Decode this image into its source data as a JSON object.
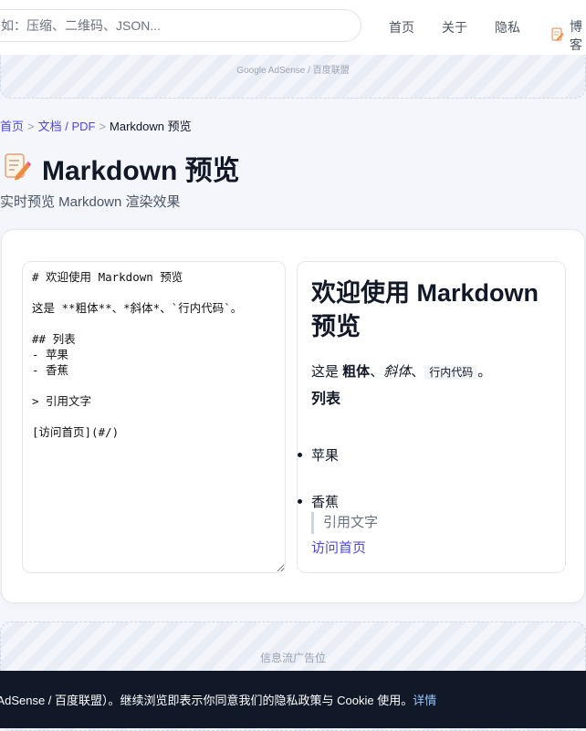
{
  "header": {
    "search_placeholder": "如：压缩、二维码、JSON...",
    "nav": {
      "home": "首页",
      "about": "关于",
      "privacy": "隐私",
      "blog": "博客"
    }
  },
  "ad_top": {
    "label": "Google AdSense / 百度联盟"
  },
  "breadcrumb": {
    "home": "首页",
    "sep": ">",
    "category": "文档 / PDF",
    "current": "Markdown 预览"
  },
  "page": {
    "icon": "memo-pencil-icon",
    "title": "Markdown 预览",
    "subtitle": "实时预览 Markdown 渲染效果"
  },
  "editor": {
    "value": "# 欢迎使用 Markdown 预览\n\n这是 **粗体**、*斜体*、`行内代码`。\n\n## 列表\n- 苹果\n- 香蕉\n\n> 引用文字\n\n[访问首页](#/)"
  },
  "preview": {
    "h1": "欢迎使用 Markdown 预览",
    "p_prefix": "这是 ",
    "bold": "粗体",
    "sep1": "、",
    "italic": "斜体",
    "sep2": "、",
    "code": "行内代码",
    "p_suffix": "。",
    "h2": "列表",
    "items": [
      "苹果",
      "香蕉"
    ],
    "quote": "引用文字",
    "link": "访问首页"
  },
  "ad_feed": {
    "label": "信息流广告位"
  },
  "cookie": {
    "text": "本站可能使用 Google AdSense / 百度联盟）。继续浏览即表示你同意我们的隐私政策与 Cookie 使用。",
    "link": "详情"
  },
  "colors": {
    "accent": "#4f46e5",
    "cookie_bg": "#111827",
    "cookie_link": "#93c5fd"
  }
}
